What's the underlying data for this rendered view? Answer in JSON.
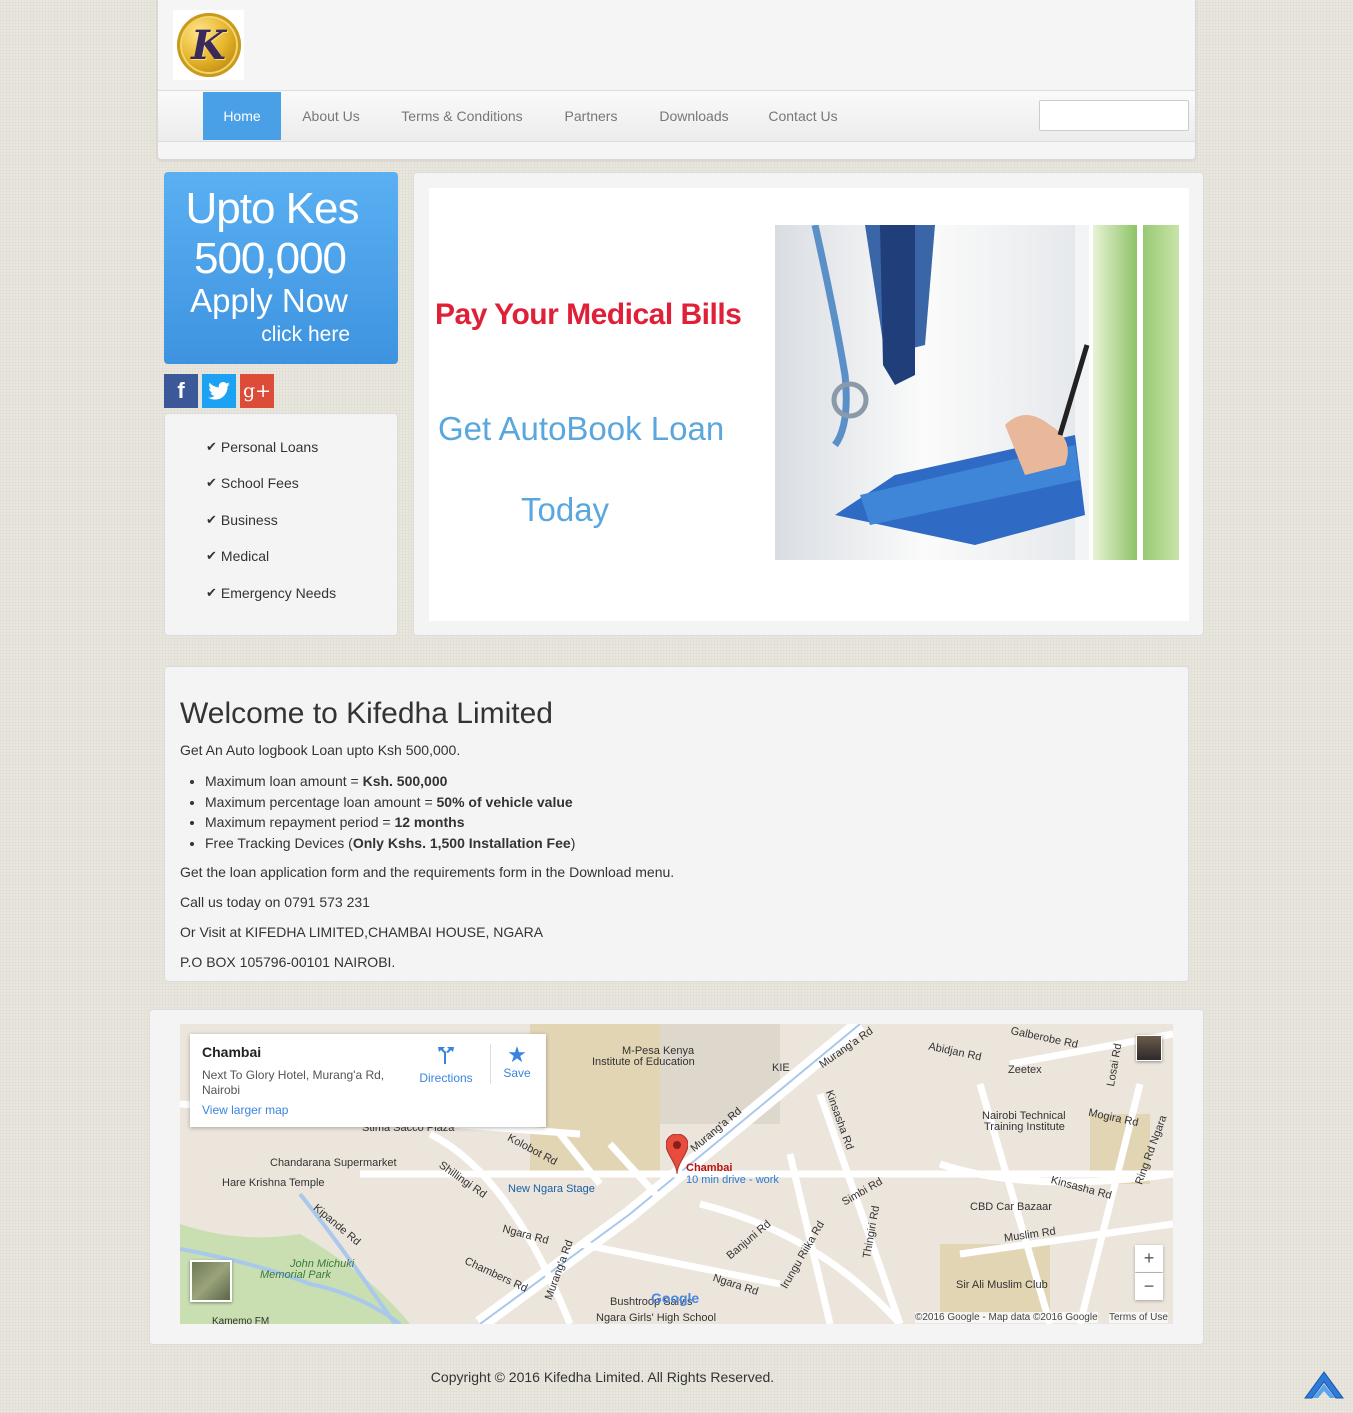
{
  "header": {
    "logo_letter": "K",
    "nav": [
      "Home",
      "About Us",
      "Terms & Conditions",
      "Partners",
      "Downloads",
      "Contact Us"
    ],
    "search_placeholder": ""
  },
  "banner": {
    "line1": "Upto Kes",
    "line2": "500,000",
    "line3": "Apply Now",
    "line4": "click here"
  },
  "social": {
    "facebook": "f",
    "twitter": "twitter-bird-icon",
    "googleplus": "g+"
  },
  "loan_types": [
    "Personal Loans",
    "School Fees",
    "Business",
    "Medical",
    "Emergency Needs"
  ],
  "slide": {
    "headline": "Pay Your Medical Bills",
    "line2": "Get AutoBook Loan",
    "line3": "Today"
  },
  "welcome": {
    "title": "Welcome to Kifedha Limited",
    "intro": "Get An Auto logbook Loan upto Ksh 500,000.",
    "bullets": [
      {
        "text": "Maximum loan amount = ",
        "bold": "Ksh. 500,000",
        "after": ""
      },
      {
        "text": "Maximum percentage loan amount = ",
        "bold": "50% of vehicle value",
        "after": ""
      },
      {
        "text": "Maximum repayment period = ",
        "bold": "12 months",
        "after": ""
      },
      {
        "text": "Free Tracking Devices (",
        "bold": "Only Kshs. 1,500 Installation Fee",
        "after": ")"
      }
    ],
    "download_note": "Get the loan application form and the requirements form in the Download menu.",
    "call": "Call us today on 0791 573 231",
    "visit": "Or Visit at KIFEDHA LIMITED,CHAMBAI HOUSE, NGARA",
    "pobox": "P.O BOX 105796-00101 NAIROBI."
  },
  "map": {
    "place_name": "Chambai",
    "address_line1": "Next To Glory Hotel, Murang'a Rd,",
    "address_line2": "Nairobi",
    "view_larger": "View larger map",
    "directions": "Directions",
    "save": "Save",
    "pin_label": "Chambai",
    "pin_sub": "10 min drive - work",
    "labels": {
      "mpesa": "M-Pesa Kenya",
      "institute": "Institute of Education",
      "kie": "KIE",
      "galberobe": "Galberobe Rd",
      "abidjan": "Abidjan Rd",
      "zeetex": "Zeetex",
      "losai": "Losai Rd",
      "mogira": "Mogira Rd",
      "nti1": "Nairobi Technical",
      "nti2": "Training Institute",
      "ringrd": "Ring Rd Ngara",
      "kinsasha": "Kinsasha Rd",
      "kinsasha2": "Kinsasha Rd",
      "murangarda": "Murang'a Rd",
      "murangarda2": "Murang'a Rd",
      "murangarda3": "Murang'a Rd",
      "stima": "Stima Sacco Plaza",
      "kolobot": "Kolobot Rd",
      "chandarana": "Chandarana Supermarket",
      "harekrishna": "Hare Krishna Temple",
      "shillingi": "Shillingi Rd",
      "newngara": "New Ngara Stage",
      "kipande": "Kipande Rd",
      "ngara": "Ngara Rd",
      "ngara2": "Ngara Rd",
      "chambers": "Chambers Rd",
      "johnmichuki1": "John Michuki",
      "johnmichuki2": "Memorial Park",
      "simbi": "Simbi Rd",
      "cbd": "CBD Car Bazaar",
      "muslim": "Muslim Rd",
      "irungu": "Irungu Riika Rd",
      "banjuni": "Banjuni Rd",
      "thingiri": "Thingiri Rd",
      "sirali": "Sir Ali Muslim Club",
      "bushtroop": "Bushtroop Salvis",
      "ngaragirls": "Ngara Girls' High School",
      "kamemo": "Kamemo FM",
      "google": "Google",
      "copyright": "©2016 Google - Map data ©2016 Google",
      "terms": "Terms of Use",
      "zoom_in": "+",
      "zoom_out": "−"
    }
  },
  "footer": {
    "copyright": "Copyright © 2016 Kifedha Limited. All Rights Reserved."
  }
}
